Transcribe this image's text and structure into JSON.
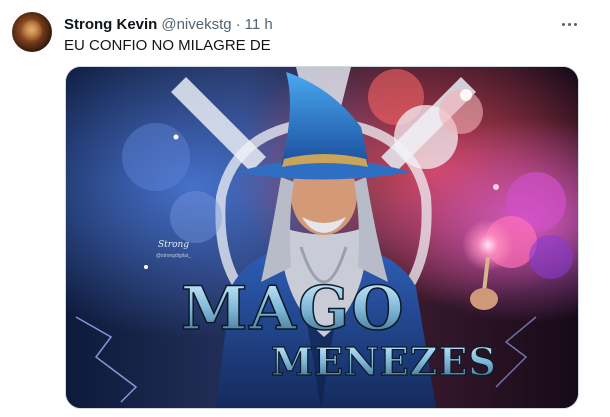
{
  "tweet": {
    "author_name": "Strong Kevin",
    "handle": "@nivekstg",
    "separator": "·",
    "time": "11 h",
    "text": "EU CONFIO NO MILAGRE DE"
  },
  "media": {
    "title_line_1": "MAGO",
    "title_line_2": "MENEZES",
    "watermark_brand": "Strong",
    "watermark_handle": "@strongdigital_"
  },
  "icons": {
    "more": "more-options-icon",
    "avatar": "avatar"
  },
  "colors": {
    "text_primary": "#0f1419",
    "text_secondary": "#536471",
    "border": "#cfd9de"
  }
}
